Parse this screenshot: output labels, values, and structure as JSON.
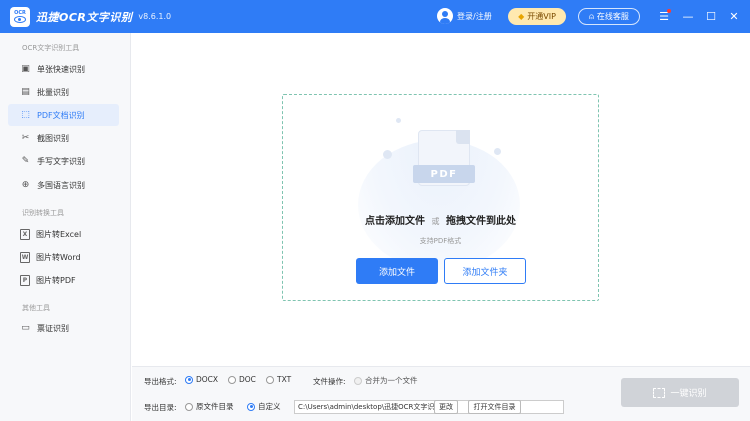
{
  "app": {
    "title": "迅捷OCR文字识别",
    "version": "v8.6.1.0",
    "logo_text": "OCR",
    "login_label": "登录/注册",
    "vip_label": "开通VIP",
    "service_label": "在线客服"
  },
  "window_controls": {
    "menu": "☰",
    "minimize": "—",
    "maximize": "☐",
    "close": "✕"
  },
  "sidebar": {
    "sections": [
      {
        "title": "OCR文字识别工具",
        "items": [
          {
            "label": "单张快速识别",
            "icon": "image-icon",
            "glyph": "▣"
          },
          {
            "label": "批量识别",
            "icon": "batch-images-icon",
            "glyph": "▤"
          },
          {
            "label": "PDF文档识别",
            "icon": "pdf-icon",
            "glyph": "⬚",
            "active": true
          },
          {
            "label": "截图识别",
            "icon": "screenshot-icon",
            "glyph": "✂"
          },
          {
            "label": "手写文字识别",
            "icon": "pen-icon",
            "glyph": "✎"
          },
          {
            "label": "多国语言识别",
            "icon": "globe-icon",
            "glyph": "⊕"
          }
        ]
      },
      {
        "title": "识别转换工具",
        "items": [
          {
            "label": "图片转Excel",
            "icon": "excel-icon",
            "glyph": "X"
          },
          {
            "label": "图片转Word",
            "icon": "word-icon",
            "glyph": "W"
          },
          {
            "label": "图片转PDF",
            "icon": "pdf-file-icon",
            "glyph": "P"
          }
        ]
      },
      {
        "title": "其他工具",
        "items": [
          {
            "label": "票证识别",
            "icon": "ticket-icon",
            "glyph": "▭"
          }
        ]
      }
    ]
  },
  "dropzone": {
    "pdf_badge": "PDF",
    "title_add": "点击添加文件",
    "title_or": "或",
    "title_drag": "拖拽文件到此处",
    "hint": "支持PDF格式",
    "add_file_button": "添加文件",
    "add_folder_button": "添加文件夹"
  },
  "bottom": {
    "format_label": "导出格式:",
    "formats": [
      {
        "label": "DOCX",
        "selected": true
      },
      {
        "label": "DOC",
        "selected": false
      },
      {
        "label": "TXT",
        "selected": false
      }
    ],
    "file_op_label": "文件操作:",
    "merge_label": "合并为一个文件",
    "dir_label": "导出目录:",
    "dir_original": "原文件目录",
    "dir_custom": "自定义",
    "path_value": "C:\\Users\\admin\\desktop\\迅捷OCR文字识别",
    "change_button": "更改",
    "open_folder_button": "打开文件目录",
    "recognize_button": "一键识别"
  },
  "colors": {
    "accent": "#2f7cf6",
    "disabled": "#d0d3d8"
  }
}
